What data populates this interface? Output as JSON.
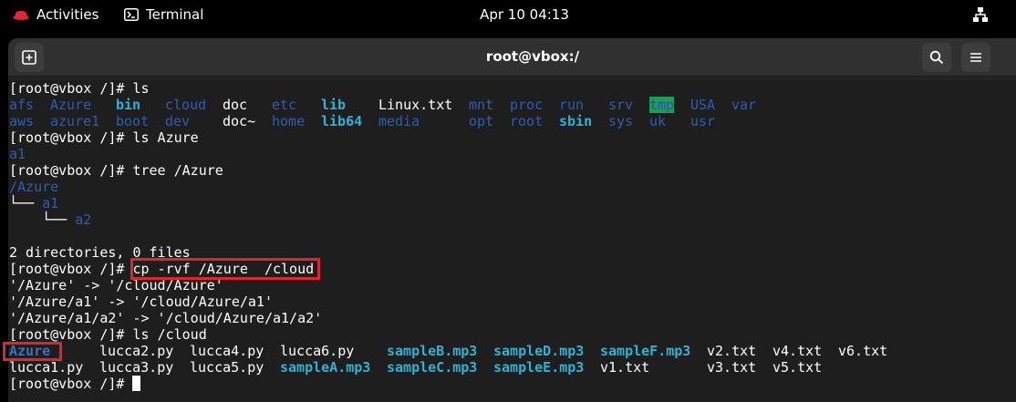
{
  "topbar": {
    "activities_label": "Activities",
    "app_label": "Terminal",
    "clock": "Apr 10  04:13"
  },
  "window": {
    "title": "root@vbox:/"
  },
  "colors": {
    "directory": "#2b5eb4",
    "bold_directory": "#3a6fcd",
    "audio_file": "#28a6c8",
    "highlight_border": "#e0262a",
    "sticky_dir_bg": "#1f9d55"
  },
  "terminal": {
    "prompt": "[root@vbox /]# ",
    "cmd_ls": "ls",
    "ls_row1": [
      "afs",
      "Azure",
      "bin",
      "cloud",
      "doc",
      "etc",
      "lib",
      "Linux.txt",
      "mnt",
      "proc",
      "run",
      "srv",
      "tmp",
      "USA",
      "var"
    ],
    "ls_row2": [
      "aws",
      "azure1",
      "boot",
      "dev",
      "doc~",
      "home",
      "lib64",
      "media",
      "opt",
      "root",
      "sbin",
      "sys",
      "uk",
      "usr"
    ],
    "cmd_ls_azure": "ls Azure",
    "ls_azure_out": "a1",
    "cmd_tree": "tree /Azure",
    "tree_root": "/Azure",
    "tree_branch1": "└── ",
    "tree_node1": "a1",
    "tree_branch2": "    └── ",
    "tree_node2": "a2",
    "tree_summary": "2 directories, 0 files",
    "cmd_cp": "cp -rvf /Azure  /cloud",
    "cp_out": [
      "'/Azure' -> '/cloud/Azure'",
      "'/Azure/a1' -> '/cloud/Azure/a1'",
      "'/Azure/a1/a2' -> '/cloud/Azure/a1/a2'"
    ],
    "cmd_ls_cloud": "ls /cloud",
    "cloud_row1": [
      "Azure",
      "lucca2.py",
      "lucca4.py",
      "lucca6.py",
      "sampleB.mp3",
      "sampleD.mp3",
      "sampleF.mp3",
      "v2.txt",
      "v4.txt",
      "v6.txt"
    ],
    "cloud_row2": [
      "lucca1.py",
      "lucca3.py",
      "lucca5.py",
      "sampleA.mp3",
      "sampleC.mp3",
      "sampleE.mp3",
      "v1.txt",
      "v3.txt",
      "v5.txt"
    ]
  }
}
